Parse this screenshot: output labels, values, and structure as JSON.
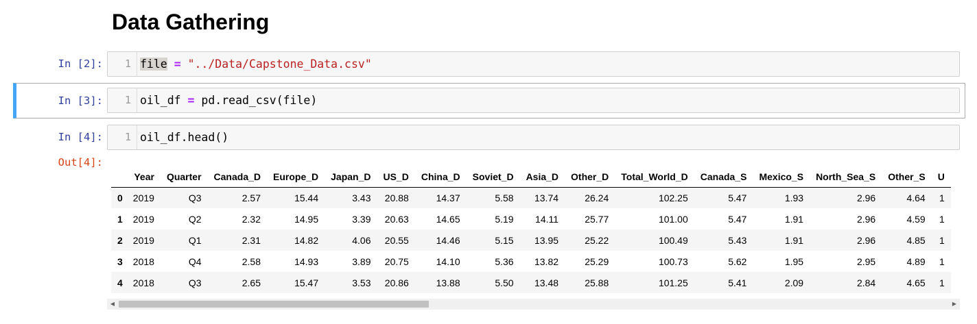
{
  "heading": "Data Gathering",
  "cells": [
    {
      "prompt": "In [2]:",
      "line": "1",
      "code": {
        "var": "file",
        "sp1": " ",
        "op": "=",
        "sp2": " ",
        "str": "\"../Data/Capstone_Data.csv\""
      }
    },
    {
      "prompt": "In [3]:",
      "line": "1",
      "code": {
        "lhs": "oil_df",
        "sp1": " ",
        "op": "=",
        "sp2": " ",
        "rhs": "pd.read_csv(file)"
      }
    },
    {
      "prompt": "In [4]:",
      "line": "1",
      "code": {
        "text": "oil_df.head()"
      },
      "out_prompt": "Out[4]:"
    }
  ],
  "dataframe": {
    "columns": [
      "Year",
      "Quarter",
      "Canada_D",
      "Europe_D",
      "Japan_D",
      "US_D",
      "China_D",
      "Soviet_D",
      "Asia_D",
      "Other_D",
      "Total_World_D",
      "Canada_S",
      "Mexico_S",
      "North_Sea_S",
      "Other_S",
      "U"
    ],
    "rows": [
      {
        "index": "0",
        "cells": [
          "2019",
          "Q3",
          "2.57",
          "15.44",
          "3.43",
          "20.88",
          "14.37",
          "5.58",
          "13.74",
          "26.24",
          "102.25",
          "5.47",
          "1.93",
          "2.96",
          "4.64",
          "1"
        ]
      },
      {
        "index": "1",
        "cells": [
          "2019",
          "Q2",
          "2.32",
          "14.95",
          "3.39",
          "20.63",
          "14.65",
          "5.19",
          "14.11",
          "25.77",
          "101.00",
          "5.47",
          "1.91",
          "2.96",
          "4.59",
          "1"
        ]
      },
      {
        "index": "2",
        "cells": [
          "2019",
          "Q1",
          "2.31",
          "14.82",
          "4.06",
          "20.55",
          "14.46",
          "5.15",
          "13.95",
          "25.22",
          "100.49",
          "5.43",
          "1.91",
          "2.96",
          "4.85",
          "1"
        ]
      },
      {
        "index": "3",
        "cells": [
          "2018",
          "Q4",
          "2.58",
          "14.93",
          "3.89",
          "20.75",
          "14.10",
          "5.36",
          "13.82",
          "25.29",
          "100.73",
          "5.62",
          "1.95",
          "2.95",
          "4.89",
          "1"
        ]
      },
      {
        "index": "4",
        "cells": [
          "2018",
          "Q3",
          "2.65",
          "15.47",
          "3.53",
          "20.86",
          "13.88",
          "5.50",
          "13.48",
          "25.88",
          "101.25",
          "5.41",
          "2.09",
          "2.84",
          "4.65",
          "1"
        ]
      }
    ]
  },
  "scrollbar": {
    "left_arrow": "◀",
    "right_arrow": "▶"
  },
  "colors": {
    "prompt_in": "#303f9f",
    "prompt_out": "#d84315",
    "selected_cell_border": "#42a5f5",
    "operator": "#aa22ff",
    "string": "#ba2121"
  }
}
